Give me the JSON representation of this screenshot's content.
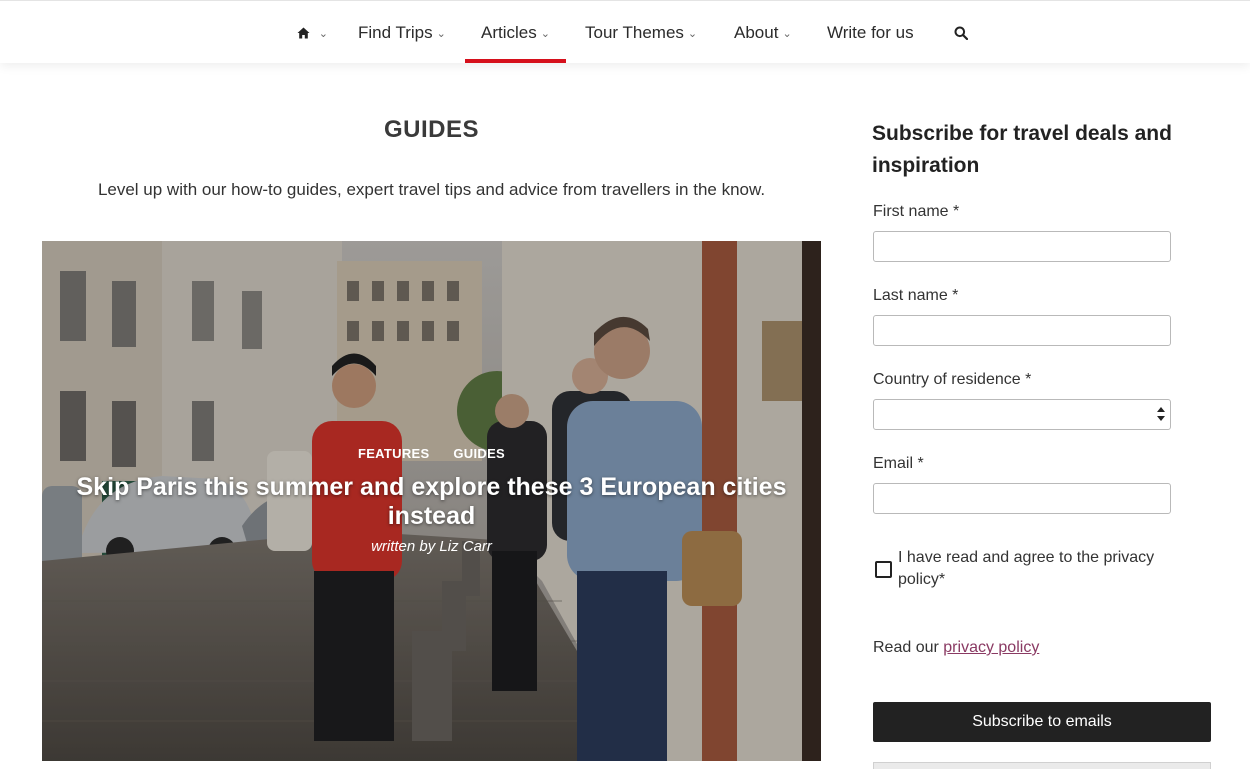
{
  "nav": {
    "home_icon": "home-icon",
    "items": [
      {
        "label": "Find Trips",
        "has_dropdown": true
      },
      {
        "label": "Articles",
        "has_dropdown": true,
        "active": true
      },
      {
        "label": "Tour Themes",
        "has_dropdown": true
      },
      {
        "label": "About",
        "has_dropdown": true
      },
      {
        "label": "Write for us",
        "has_dropdown": false
      }
    ],
    "search_icon": "search-icon",
    "chevron": "⌄",
    "active_color": "#d6101c"
  },
  "main": {
    "title": "GUIDES",
    "description": "Level up with our how-to guides, expert travel tips and advice from travellers in the know.",
    "featured": {
      "categories": [
        "FEATURES",
        "GUIDES"
      ],
      "title": "Skip Paris this summer and explore these 3 European cities instead",
      "author": "written by Liz Carr"
    }
  },
  "sidebar": {
    "heading": "Subscribe for travel deals and inspiration",
    "fields": {
      "first_name": {
        "label": "First name *",
        "value": ""
      },
      "last_name": {
        "label": "Last name *",
        "value": ""
      },
      "country": {
        "label": "Country of residence *",
        "value": ""
      },
      "email": {
        "label": "Email *",
        "value": ""
      }
    },
    "consent": {
      "text": "I have read and agree to the privacy policy*",
      "checked": false
    },
    "privacy_prefix": "Read our",
    "privacy_link": "privacy policy",
    "submit_label": "Subscribe to emails",
    "button_color": "#222222",
    "link_color": "#8a3a63"
  }
}
